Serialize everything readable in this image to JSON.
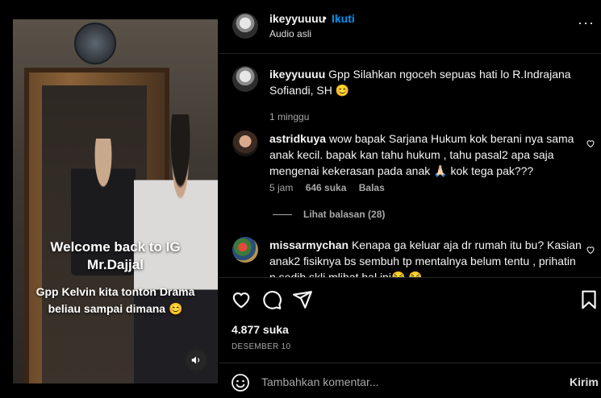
{
  "video": {
    "caption_line1": "Welcome back to IG",
    "caption_line2": "Mr.Dajjal",
    "caption_sub": "Gpp Kelvin kita tonton Drama beliau sampai dimana 😊",
    "sound_icon": "speaker-icon"
  },
  "header": {
    "username": "ikeyyuuuu",
    "separator": "•",
    "follow_label": "Ikuti",
    "audio_label": "Audio asli",
    "more_label": "···"
  },
  "caption": {
    "username": "ikeyyuuuu",
    "text": "Gpp Silahkan ngoceh sepuas hati lo R.Indrajana Sofiandi, SH 😊",
    "time": "1 minggu"
  },
  "comments": [
    {
      "username": "astridkuya",
      "text": "wow bapak Sarjana Hukum kok berani nya sama anak kecil. bapak kan tahu hukum , tahu pasal2 apa saja mengenai kekerasan pada anak 🙏🏻 kok tega pak???",
      "time": "5 jam",
      "likes": "646 suka",
      "reply": "Balas",
      "view_replies": "Lihat balasan (28)"
    },
    {
      "username": "missarmychan",
      "text": "Kenapa ga keluar aja dr rumah itu bu? Kasian anak2 fisiknya bs sembuh tp mentalnya belum tentu , prihatin n sedih skli mlihat hal ini😂 😂"
    }
  ],
  "post": {
    "likes": "4.877 suka",
    "date": "DESEMBER 10"
  },
  "comment_box": {
    "placeholder": "Tambahkan komentar...",
    "send_label": "Kirim"
  },
  "colors": {
    "background": "#000000",
    "accent": "#0095f6",
    "muted": "#a8a8a8",
    "divider": "#262626"
  }
}
